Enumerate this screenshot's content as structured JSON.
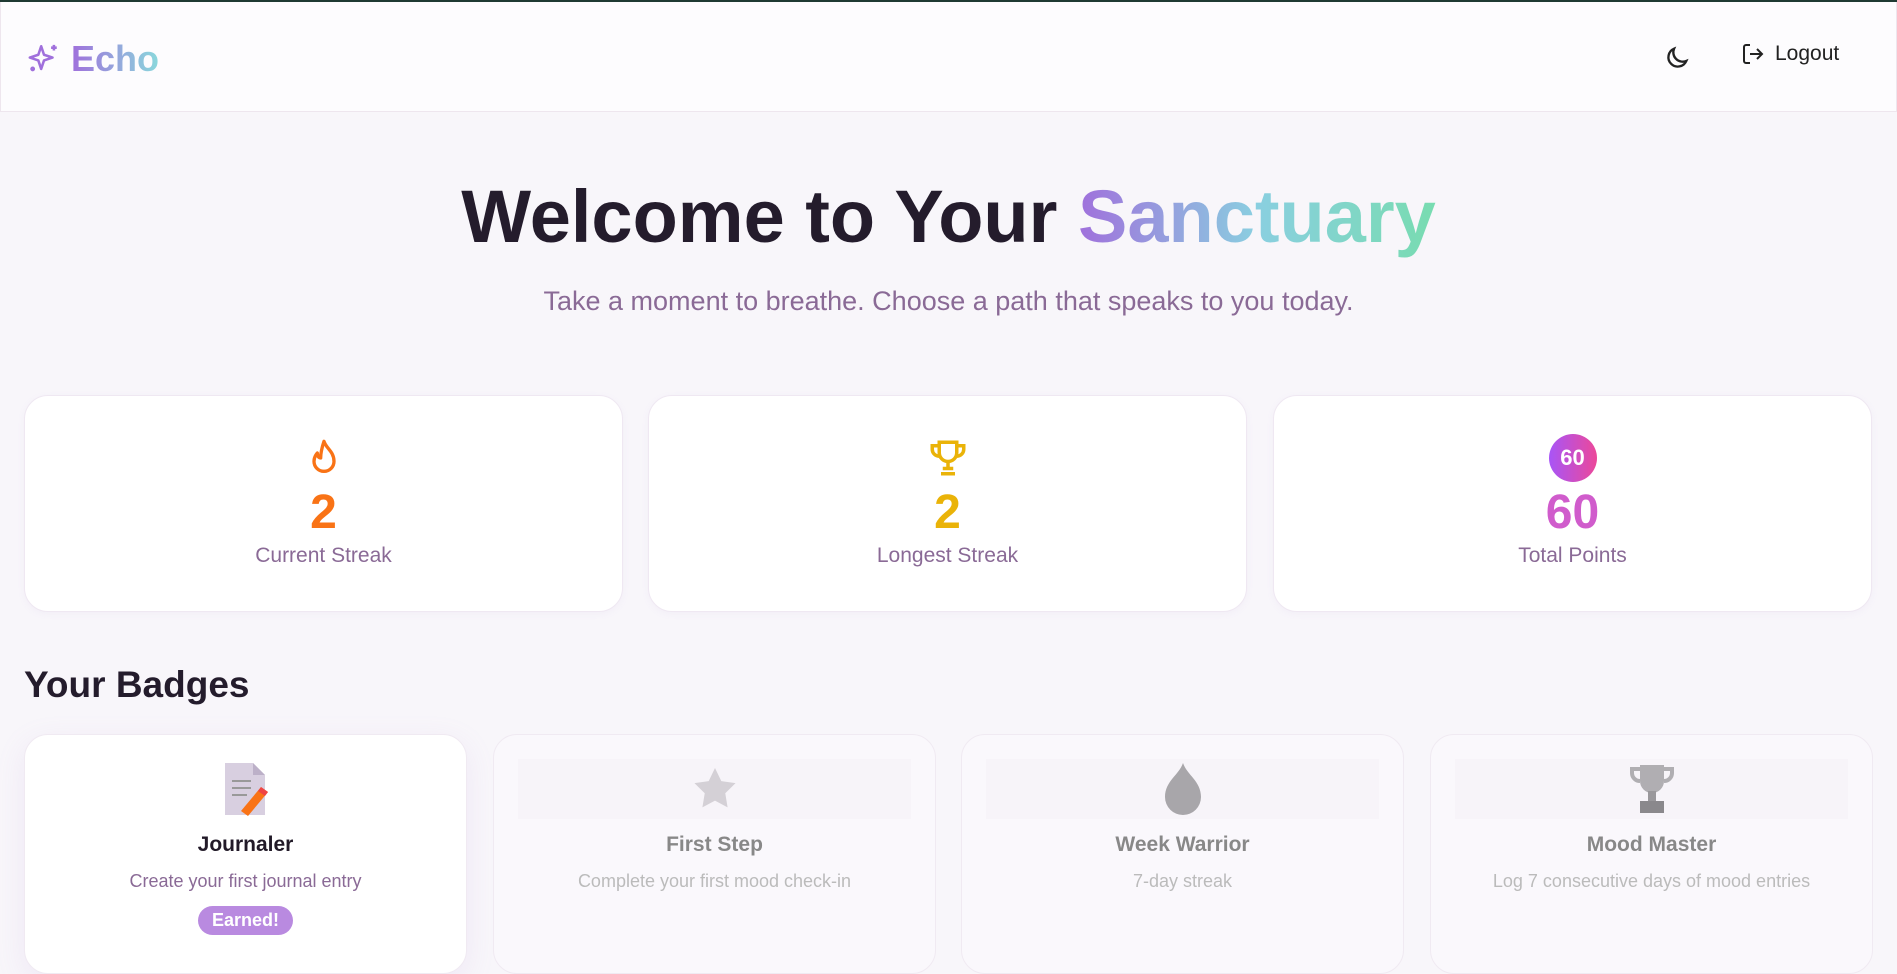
{
  "header": {
    "brand": "Echo",
    "logout_label": "Logout"
  },
  "hero": {
    "title_prefix": "Welcome to Your ",
    "title_highlight": "Sanctuary",
    "subtitle": "Take a moment to breathe. Choose a path that speaks to you today."
  },
  "stats": [
    {
      "value": "2",
      "label": "Current Streak",
      "icon": "flame-icon",
      "color": "#f97316"
    },
    {
      "value": "2",
      "label": "Longest Streak",
      "icon": "trophy-icon",
      "color": "#eab308"
    },
    {
      "value": "60",
      "label": "Total Points",
      "icon": "points-icon",
      "badge": "60",
      "color": "#d05ccc"
    }
  ],
  "badges_title": "Your Badges",
  "badges": [
    {
      "name": "Journaler",
      "desc": "Create your first journal entry",
      "status": "Earned!"
    },
    {
      "name": "First Step",
      "desc": "Complete your first mood check-in"
    },
    {
      "name": "Week Warrior",
      "desc": "7-day streak"
    },
    {
      "name": "Mood Master",
      "desc": "Log 7 consecutive days of mood entries"
    }
  ]
}
